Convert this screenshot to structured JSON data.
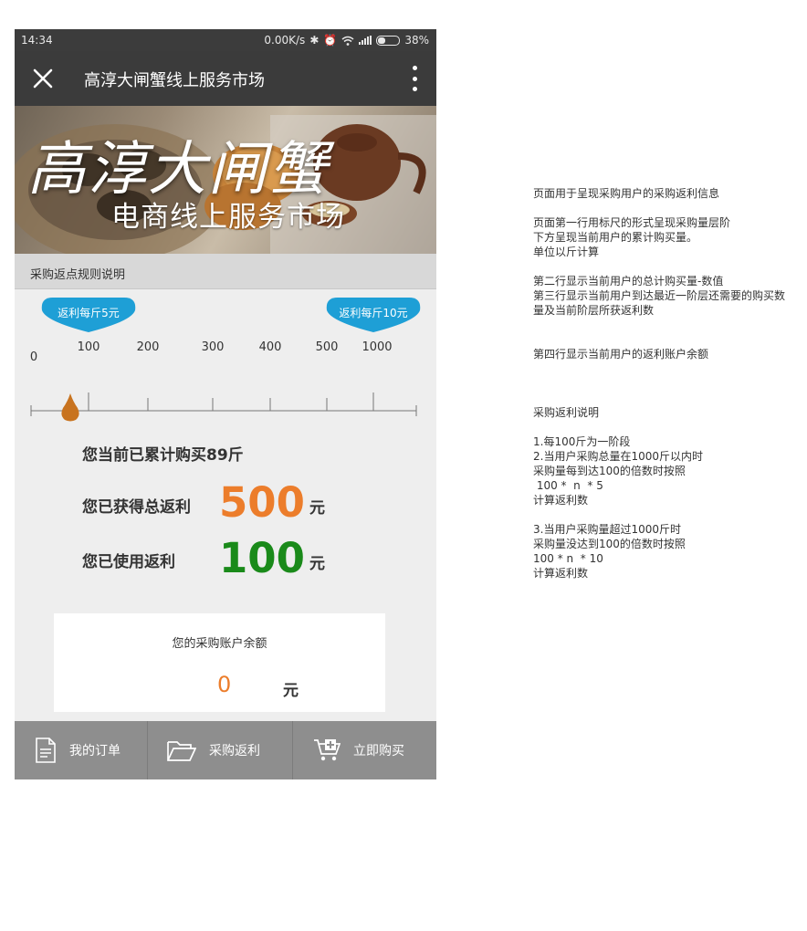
{
  "status_bar": {
    "time": "14:34",
    "speed": "0.00K/s",
    "battery": "38%"
  },
  "top_bar": {
    "title": "高淳大闸蟹线上服务市场"
  },
  "banner": {
    "calligraphy": "高淳大闸蟹",
    "subtitle": "电商线上服务市场"
  },
  "rules_link": "采购返点规则说明",
  "ruler": {
    "pins": [
      {
        "label": "返利每斤5元"
      },
      {
        "label": "返利每斤10元"
      }
    ],
    "ticks": [
      "0",
      "100",
      "200",
      "300",
      "400",
      "500",
      "1000"
    ],
    "current_purchase_jin": 89
  },
  "stats": {
    "cumulative_text": "您当前已累计购买89斤",
    "earned_label": "您已获得总返利",
    "earned_value": "500",
    "used_label": "您已使用返利",
    "used_value": "100",
    "unit": "元"
  },
  "balance": {
    "caption": "您的采购账户余额",
    "value": "0",
    "unit": "元"
  },
  "tabs": [
    {
      "label": "我的订单",
      "icon": "document-icon"
    },
    {
      "label": "采购返利",
      "icon": "folder-icon"
    },
    {
      "label": "立即购买",
      "icon": "cart-add-icon"
    }
  ],
  "colors": {
    "orange": "#ec7d2b",
    "green": "#1a8a1a",
    "pin_blue": "#1e9fd6",
    "drop": "#c8731f"
  },
  "notes": [
    "页面用于呈现采购用户的采购返利信息",
    "",
    "页面第一行用标尺的形式呈现采购量层阶",
    "下方呈现当前用户的累计购买量。",
    "单位以斤计算",
    "",
    "第二行显示当前用户的总计购买量-数值",
    "第三行显示当前用户到达最近一阶层还需要的购买数",
    "量及当前阶层所获返利数",
    "",
    "",
    "第四行显示当前用户的返利账户余额",
    "",
    "",
    "",
    "采购返利说明",
    "",
    "1.每100斤为一阶段",
    "2.当用户采购总量在1000斤以内时",
    "采购量每到达100的倍数时按照",
    " 100 *  n  * 5",
    "计算返利数",
    "",
    "3.当用户采购量超过1000斤时",
    "采购量没达到100的倍数时按照",
    "100 * n  * 10",
    "计算返利数"
  ]
}
